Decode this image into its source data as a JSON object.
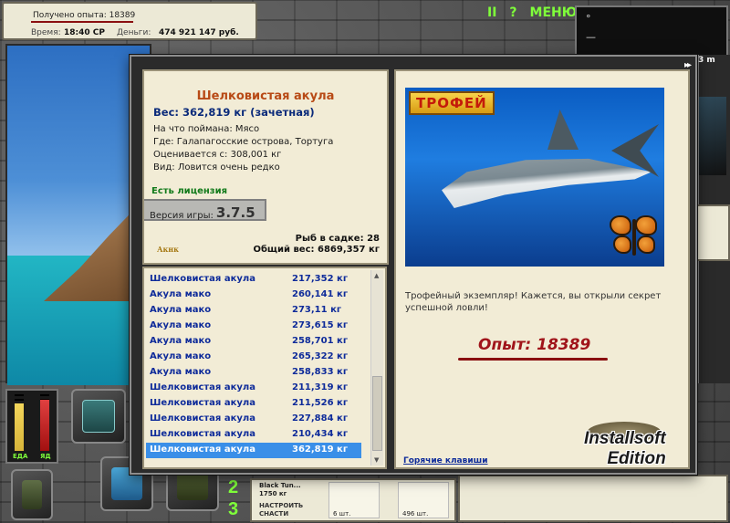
{
  "status": {
    "xp_text": "Получено опыта: 18389",
    "time_label": "Время:",
    "time_value": "18:40 СР",
    "money_label": "Деньги:",
    "money_value": "474 921 147 руб."
  },
  "topbar": {
    "pause_label": "II",
    "help_label": "?",
    "menu_label": "МЕНЮ"
  },
  "right_box": {
    "dot": "°",
    "dash": "—"
  },
  "side": {
    "m_label": "3 m"
  },
  "meters": {
    "food_label": "ЕДА",
    "poison_label": "ЯД",
    "food_level_pct": 84,
    "poison_level_pct": 90
  },
  "tackle": {
    "numbers": [
      "2",
      "3"
    ],
    "bait_name": "Black Tun...",
    "bait_weight": "1750 кг",
    "setup_label": "НАСТРОИТЬ СНАСТИ",
    "slot1_count": "6 шт.",
    "slot2_count": "496 шт."
  },
  "modal": {
    "skip_icon": "▸▸"
  },
  "fish": {
    "name": "Шелковистая акула",
    "weight": "Вес: 362,819 кг (зачетная)",
    "bait_line": "На что поймана: Мясо",
    "where_line": "Где: Галапагосские острова, Тортуга",
    "rated_line": "Оценивается с: 308,001 кг",
    "kind_line": "Вид: Ловится очень редко",
    "license": "Есть лицензия",
    "version_label": "Версия игры:",
    "version_value": "3.7.5",
    "logo": "Акнк",
    "cage_count": "Рыб в садке: 28",
    "cage_weight": "Общий вес: 6869,357 кг"
  },
  "catches": [
    {
      "name": "Шелковистая акула",
      "weight": "217,352 кг",
      "selected": false
    },
    {
      "name": "Акула мако",
      "weight": "260,141 кг",
      "selected": false
    },
    {
      "name": "Акула мако",
      "weight": "273,11 кг",
      "selected": false
    },
    {
      "name": "Акула мако",
      "weight": "273,615 кг",
      "selected": false
    },
    {
      "name": "Акула мако",
      "weight": "258,701 кг",
      "selected": false
    },
    {
      "name": "Акула мако",
      "weight": "265,322 кг",
      "selected": false
    },
    {
      "name": "Акула мако",
      "weight": "258,833 кг",
      "selected": false
    },
    {
      "name": "Шелковистая акула",
      "weight": "211,319 кг",
      "selected": false
    },
    {
      "name": "Шелковистая акула",
      "weight": "211,526 кг",
      "selected": false
    },
    {
      "name": "Шелковистая акула",
      "weight": "227,884 кг",
      "selected": false
    },
    {
      "name": "Шелковистая акула",
      "weight": "210,434 кг",
      "selected": false
    },
    {
      "name": "Шелковистая акула",
      "weight": "362,819 кг",
      "selected": true
    }
  ],
  "detail": {
    "trophy_tag": "ТРОФЕЙ",
    "message": "Трофейный экземпляр! Кажется, вы открыли секрет успешной ловли!",
    "xp": "Опыт: 18389",
    "hotkeys": "Горячие клавиши"
  },
  "watermark": {
    "line1": "Installsoft",
    "line2": "Edition"
  }
}
